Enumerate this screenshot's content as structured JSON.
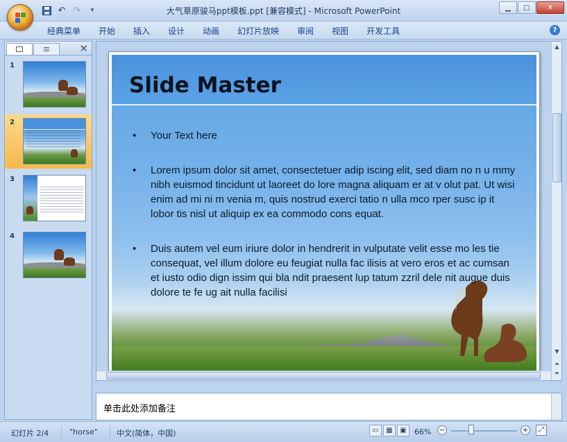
{
  "window": {
    "title": "大气草原骏马ppt模板.ppt [兼容模式] - Microsoft PowerPoint",
    "minimize_icon": "minimize-icon",
    "maximize_icon": "maximize-icon",
    "close_icon": "close-icon"
  },
  "quick_access": {
    "save_icon": "save-icon",
    "undo_icon": "undo-icon",
    "redo_icon": "redo-icon",
    "customize_icon": "customize-icon"
  },
  "ribbon": {
    "tabs": [
      "经典菜单",
      "开始",
      "插入",
      "设计",
      "动画",
      "幻灯片放映",
      "审阅",
      "视图",
      "开发工具"
    ],
    "help_label": "?"
  },
  "thumbnails": {
    "close_label": "✕",
    "items": [
      {
        "number": "1",
        "selected": false
      },
      {
        "number": "2",
        "selected": true
      },
      {
        "number": "3",
        "selected": false
      },
      {
        "number": "4",
        "selected": false
      }
    ]
  },
  "slide": {
    "title": "Slide Master",
    "bullets": [
      "Your Text here",
      "Lorem ipsum dolor sit amet, consectetuer adip iscing elit, sed diam no n u mmy nibh euismod tincidunt ut laoreet do lore magna aliquam er at v olut pat. Ut wisi enim ad mi ni m venia m, quis nostrud exerci tatio n ulla mco rper susc ip it lobor tis nisl ut aliquip ex ea commodo cons equat.",
      "Duis autem vel eum iriure dolor in hendrerit in vulputate velit esse mo les tie consequat, vel illum dolore eu feugiat nulla fac ilisis at vero eros et ac cumsan et iusto odio dign issim qui bla ndit praesent lup tatum zzril dele nit augue duis dolore te fe ug ait nulla facilisi"
    ]
  },
  "notes": {
    "placeholder": "单击此处添加备注"
  },
  "statusbar": {
    "slide_indicator": "幻灯片 2/4",
    "theme": "\"horse\"",
    "language": "中文(简体，中国)",
    "zoom": "66%",
    "zoom_level_percent": 66
  }
}
